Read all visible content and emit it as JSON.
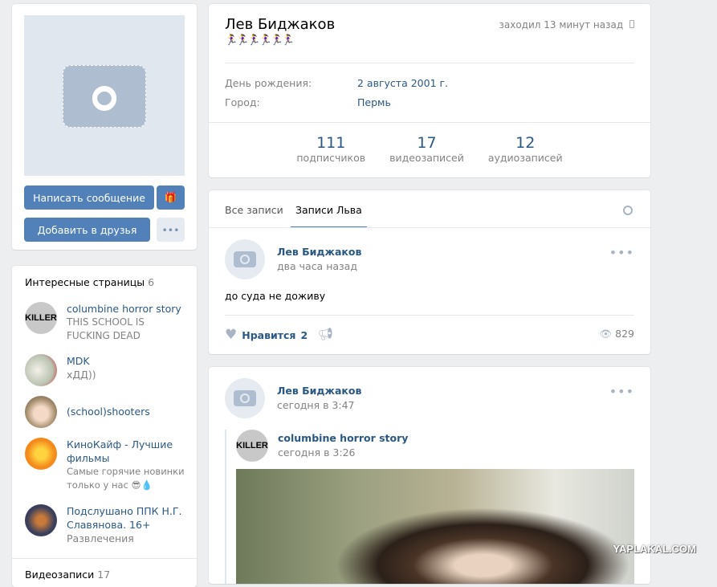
{
  "profile": {
    "name": "Лев Биджаков",
    "status_emoji": "🏃‍♀️🏃‍♀️🏃‍♀️🏃‍♀️🏃‍♀️🏃‍♀️",
    "online": "заходил 13 минут назад",
    "info": [
      {
        "label": "День рождения:",
        "value": "2 августа 2001 г."
      },
      {
        "label": "Город:",
        "value": "Пермь"
      }
    ],
    "counters": [
      {
        "value": "111",
        "label": "подписчиков"
      },
      {
        "value": "17",
        "label": "видеозаписей"
      },
      {
        "value": "12",
        "label": "аудиозаписей"
      }
    ]
  },
  "actions": {
    "message": "Написать сообщение",
    "add_friend": "Добавить в друзья",
    "more": "•••"
  },
  "pages": {
    "title": "Интересные страницы",
    "count": "6",
    "items": [
      {
        "name": "columbine horror story",
        "sub": "THIS SCHOOL IS FUCKING DEAD",
        "avatar_text": "KILLER"
      },
      {
        "name": "MDK",
        "sub": "хДД))"
      },
      {
        "name": "(school)shooters",
        "sub": ""
      },
      {
        "name": "КиноКайф - Лучшие фильмы",
        "sub": "Самые горячие новинки только у нас 😎💧"
      },
      {
        "name": "Подслушано ППК Н.Г. Славянова. 16+",
        "sub": "Развлечения"
      }
    ]
  },
  "next_block": {
    "title": "Видеозаписи",
    "count": "17"
  },
  "wall": {
    "tabs": [
      "Все записи",
      "Записи Льва"
    ],
    "active_tab": 1
  },
  "posts": [
    {
      "author": "Лев Биджаков",
      "time": "два часа назад",
      "text": "до суда не доживу",
      "likes_label": "Нравится",
      "likes": "2",
      "views": "829"
    },
    {
      "author": "Лев Биджаков",
      "time": "сегодня в 3:47",
      "repost": {
        "author": "columbine horror story",
        "time": "сегодня в 3:26",
        "avatar_text": "KILLER"
      }
    }
  ],
  "watermark": "YAPLAKAL.COM"
}
